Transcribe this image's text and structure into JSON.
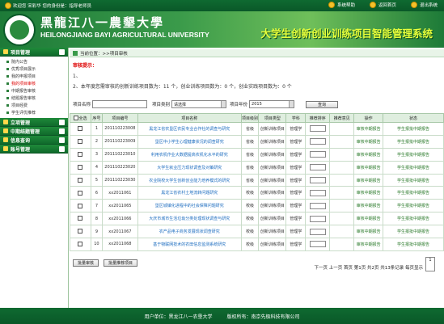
{
  "topbar": {
    "welcome": "欢迎您 宋彩华 您的身份是：指导老师员",
    "links": [
      "系统帮助",
      "返回首页",
      "退出系统"
    ]
  },
  "header": {
    "cn_name": "黑龍江八一農墾大學",
    "en_name": "HEILONGJIANG BAYI AGRICULTURAL UNIVERSITY",
    "system_title": "大学生创新创业训练项目智能管理系统"
  },
  "sidebar": {
    "groups": [
      {
        "label": "项目管理",
        "items": [
          "院内公告",
          "优秀项目展示",
          "我的申报项目",
          "我的项目审核",
          "中期报告审核",
          "结题报告审核",
          "项目经费",
          "学生评优推荐"
        ]
      },
      {
        "label": "立项管理",
        "items": []
      },
      {
        "label": "中期结题管理",
        "items": []
      },
      {
        "label": "信息查询",
        "items": []
      },
      {
        "label": "账号管理",
        "items": []
      }
    ],
    "active_item": "我的项目审核"
  },
  "breadcrumb": "当前位置：>>项目审核",
  "hint": {
    "title": "审核提示：",
    "line1": "1、",
    "line2": "2、本年度您需审核的创新训练项目数为：11 个，创业训练项目数为：0 个，创业实践项目数为：0 个"
  },
  "filter": {
    "name_label": "项目名称",
    "type_label": "项目类别",
    "type_value": "请选择",
    "year_label": "项目年份",
    "year_value": "2015",
    "query_button": "查询"
  },
  "table": {
    "headers": [
      "全选",
      "序号",
      "项目编号",
      "项目名称",
      "项目级别",
      "项目类型",
      "学科",
      "推荐排序",
      "推荐意见",
      "操作",
      "状态"
    ],
    "rows": [
      {
        "no": "1",
        "code": "201110223008",
        "name": "黑龙江省农垦区农民专业合作社的调查与研究",
        "level": "省级",
        "type": "创新训练项目",
        "subject": "管理学",
        "op": "审核中期报告",
        "status": "学生报批中期报告"
      },
      {
        "no": "2",
        "code": "201110223009",
        "name": "垦区中小学生心理健康状况的调查研究",
        "level": "省级",
        "type": "创新训练项目",
        "subject": "管理学",
        "op": "审核中期报告",
        "status": "学生报批中期报告"
      },
      {
        "no": "3",
        "code": "201110223010",
        "name": "利用农机作业大数据提高农机化水平的研究",
        "level": "省级",
        "type": "创新训练项目",
        "subject": "管理学",
        "op": "审核中期报告",
        "status": "学生报批中期报告"
      },
      {
        "no": "4",
        "code": "201110223020",
        "name": "大学生就业压力现状调查及对策研究",
        "level": "省级",
        "type": "创新训练项目",
        "subject": "管理学",
        "op": "审核中期报告",
        "status": "学生报批中期报告"
      },
      {
        "no": "5",
        "code": "201110223030",
        "name": "农业院校大学生创新创业能力培养模式的研究",
        "level": "省级",
        "type": "创新训练项目",
        "subject": "管理学",
        "op": "审核中期报告",
        "status": "学生报批中期报告"
      },
      {
        "no": "6",
        "code": "xx2011061",
        "name": "黑龙江省农村土地流转问题研究",
        "level": "校级",
        "type": "创新训练项目",
        "subject": "管理学",
        "op": "审核中期报告",
        "status": "学生报批中期报告"
      },
      {
        "no": "7",
        "code": "xx2011065",
        "name": "垦区城镇化进程中的社会保障问题研究",
        "level": "校级",
        "type": "创新训练项目",
        "subject": "管理学",
        "op": "审核中期报告",
        "status": "学生报批中期报告"
      },
      {
        "no": "8",
        "code": "xx2011066",
        "name": "大庆市城市生活垃圾分类处理现状调查与研究",
        "level": "校级",
        "type": "创新训练项目",
        "subject": "管理学",
        "op": "审核中期报告",
        "status": "学生报批中期报告"
      },
      {
        "no": "9",
        "code": "xx2011067",
        "name": "农产品电子商务发展现状调查研究",
        "level": "校级",
        "type": "创新训练项目",
        "subject": "管理学",
        "op": "审核中期报告",
        "status": "学生报批中期报告"
      },
      {
        "no": "10",
        "code": "xx2011068",
        "name": "基于物联网技术的农田信息监测系统研究",
        "level": "校级",
        "type": "创新训练项目",
        "subject": "管理学",
        "op": "审核中期报告",
        "status": "学生报批中期报告"
      }
    ]
  },
  "actions": {
    "submit_midterm": "批量审核",
    "submit_conclusion": "批量推荐项目"
  },
  "pager": {
    "text": "下一页 上一页 首页 第1页 共2页 共13条记录 每页显示",
    "page_size": "1"
  },
  "footer": {
    "unit": "用户单位：黑龙江八一农垦大学",
    "copyright": "版权所有：南京先极科技有限公司"
  }
}
